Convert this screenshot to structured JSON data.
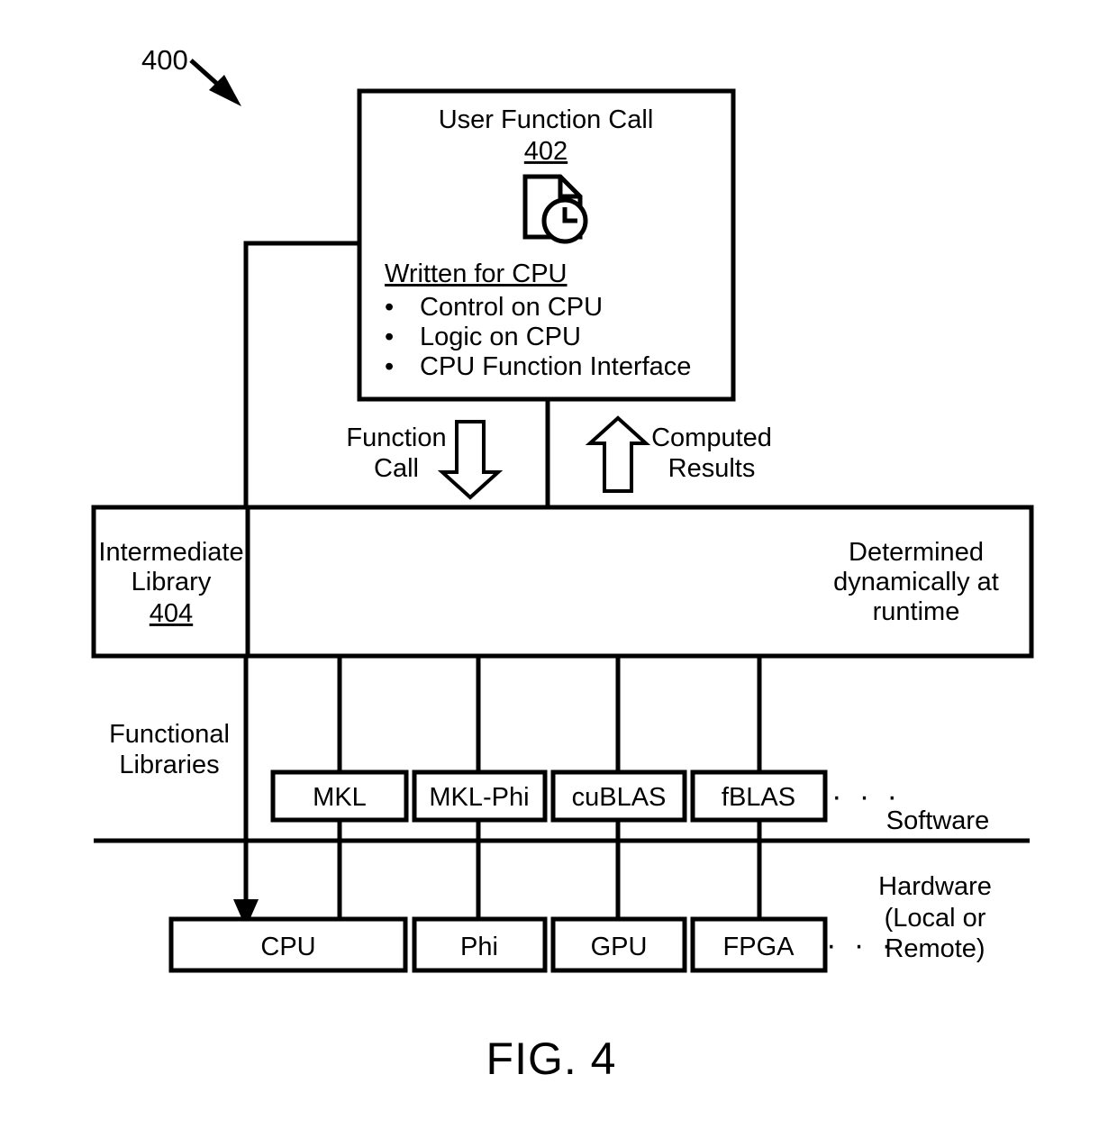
{
  "figure": {
    "caption": "FIG. 4",
    "reference_numeral": "400"
  },
  "user_function_call": {
    "title": "User Function Call",
    "number": "402",
    "icon": "document-clock-icon",
    "section_heading": "Written for CPU",
    "bullets": [
      "Control on CPU",
      "Logic on CPU",
      "CPU Function Interface"
    ]
  },
  "flows": {
    "down": {
      "line1": "Function",
      "line2": "Call",
      "arrow": "hollow-down-arrow"
    },
    "up": {
      "line1": "Computed",
      "line2": "Results",
      "arrow": "hollow-up-arrow"
    }
  },
  "intermediate_library": {
    "line1": "Intermediate",
    "line2": "Library",
    "number": "404",
    "note_line1": "Determined",
    "note_line2": "dynamically at",
    "note_line3": "runtime"
  },
  "functional_libraries": {
    "side_label_line1": "Functional",
    "side_label_line2": "Libraries",
    "boxes": [
      {
        "label": "MKL"
      },
      {
        "label": "MKL-Phi"
      },
      {
        "label": "cuBLAS"
      },
      {
        "label": "fBLAS"
      }
    ],
    "ellipsis": "· · ·"
  },
  "layers": {
    "software": "Software",
    "hardware_line1": "Hardware",
    "hardware_line2": "(Local or",
    "hardware_line3": "Remote)"
  },
  "hardware": {
    "boxes": [
      {
        "label": "CPU"
      },
      {
        "label": "Phi"
      },
      {
        "label": "GPU"
      },
      {
        "label": "FPGA"
      }
    ],
    "ellipsis": "· · ·"
  },
  "colors": {
    "stroke": "#000000",
    "background": "#ffffff"
  }
}
